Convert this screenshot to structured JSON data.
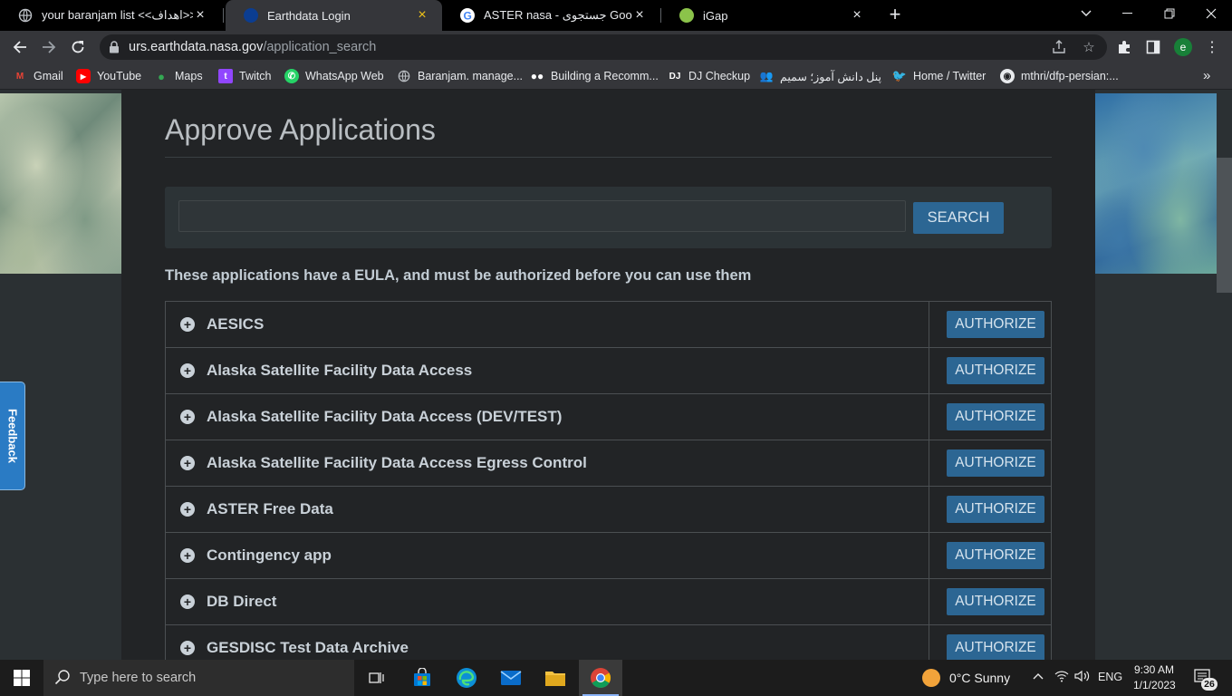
{
  "browser": {
    "tabs": [
      {
        "title": "your baranjam list <<اهداف>>",
        "icon": "globe-icon"
      },
      {
        "title": "Earthdata Login",
        "icon": "nasa-icon",
        "active": true
      },
      {
        "title": "ASTER nasa - جستجوی Google",
        "icon": "google-icon"
      },
      {
        "title": "iGap",
        "icon": "igap-icon"
      }
    ],
    "new_tab": "+",
    "url": {
      "domain": "urs.earthdata.nasa.gov",
      "path": "/application_search"
    },
    "profile_initial": "e"
  },
  "bookmarks": [
    {
      "label": "Gmail",
      "icon": "gmail-icon"
    },
    {
      "label": "YouTube",
      "icon": "youtube-icon"
    },
    {
      "label": "Maps",
      "icon": "maps-icon"
    },
    {
      "label": "Twitch",
      "icon": "twitch-icon"
    },
    {
      "label": "WhatsApp Web",
      "icon": "whatsapp-icon"
    },
    {
      "label": "Baranjam. manage...",
      "icon": "globe-icon"
    },
    {
      "label": "Building a Recomm...",
      "icon": "medium-icon"
    },
    {
      "label": "DJ Checkup",
      "icon": "dj-icon"
    },
    {
      "label": "پنل دانش آموز؛ سمیم",
      "icon": "people-icon"
    },
    {
      "label": "Home / Twitter",
      "icon": "twitter-icon"
    },
    {
      "label": "mthri/dfp-persian:...",
      "icon": "github-icon"
    }
  ],
  "page": {
    "title": "Approve Applications",
    "search": {
      "value": "",
      "button_label": "SEARCH"
    },
    "eula_note": "These applications have a EULA, and must be authorized before you can use them",
    "applications": [
      {
        "name": "AESICS",
        "button_label": "AUTHORIZE"
      },
      {
        "name": "Alaska Satellite Facility Data Access",
        "button_label": "AUTHORIZE"
      },
      {
        "name": "Alaska Satellite Facility Data Access (DEV/TEST)",
        "button_label": "AUTHORIZE"
      },
      {
        "name": "Alaska Satellite Facility Data Access Egress Control",
        "button_label": "AUTHORIZE"
      },
      {
        "name": "ASTER Free Data",
        "button_label": "AUTHORIZE"
      },
      {
        "name": "Contingency app",
        "button_label": "AUTHORIZE"
      },
      {
        "name": "DB Direct",
        "button_label": "AUTHORIZE"
      },
      {
        "name": "GESDISC Test Data Archive",
        "button_label": "AUTHORIZE"
      }
    ],
    "feedback_label": "Feedback"
  },
  "taskbar": {
    "search_placeholder": "Type here to search",
    "weather": "0°C  Sunny",
    "language": "ENG",
    "time": "9:30 AM",
    "date": "1/1/2023",
    "notification_count": "26"
  },
  "colors": {
    "accent_button": "#2c6693",
    "content_bg": "#222426",
    "feedback_tab": "#2a7bc4"
  }
}
